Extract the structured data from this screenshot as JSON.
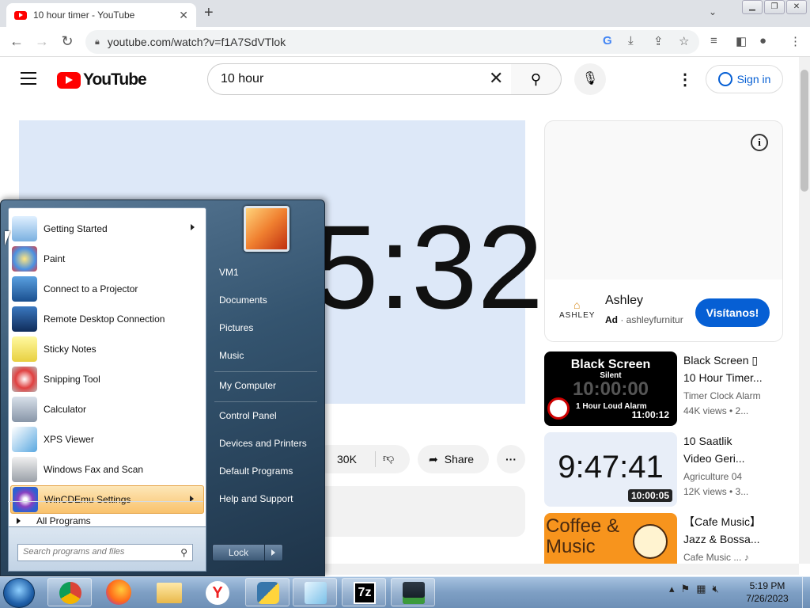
{
  "browser": {
    "tab_title": "10 hour timer - YouTube",
    "url": "youtube.com/watch?v=f1A7SdVTlok",
    "new_tab": "+",
    "close_tab": "✕"
  },
  "youtube": {
    "logo_text": "YouTube",
    "search_value": "10 hour",
    "sign_in": "Sign in",
    "timer_display": "5:32",
    "likes": "30K",
    "share": "Share",
    "more": "···"
  },
  "ad": {
    "brand_logo": "ASHLEY",
    "name": "Ashley",
    "ad_label": "Ad",
    "domain": "· ashleyfurnitur",
    "cta": "Visítanos!"
  },
  "recommended": [
    {
      "title1": "Black Screen ▯",
      "title2": "10 Hour Timer...",
      "channel": "Timer Clock Alarm",
      "stats": "44K views • 2...",
      "duration": "11:00:12",
      "thumb_main": "Black Screen",
      "thumb_sub": "Silent",
      "thumb_ghost": "10:00:00",
      "thumb_caption": "1 Hour Loud Alarm"
    },
    {
      "title1": "10 Saatlik",
      "title2": "Video Geri...",
      "channel": "Agriculture 04",
      "stats": "12K views • 3...",
      "duration": "10:00:05",
      "thumb_main": "9:47:41"
    },
    {
      "title1": "【Cafe Music】",
      "title2": "Jazz & Bossa...",
      "channel": "Cafe Music ... ♪",
      "thumb_main": "Coffee & Music"
    }
  ],
  "start_menu": {
    "programs": [
      {
        "label": "Getting Started",
        "submenu": true
      },
      {
        "label": "Paint"
      },
      {
        "label": "Connect to a Projector"
      },
      {
        "label": "Remote Desktop Connection"
      },
      {
        "label": "Sticky Notes"
      },
      {
        "label": "Snipping Tool"
      },
      {
        "label": "Calculator"
      },
      {
        "label": "XPS Viewer"
      },
      {
        "label": "Windows Fax and Scan"
      },
      {
        "label": "WinCDEmu Settings",
        "submenu": true
      }
    ],
    "all_programs": "All Programs",
    "search_placeholder": "Search programs and files",
    "right_links": [
      "VM1",
      "Documents",
      "Pictures",
      "Music",
      "My Computer",
      "Control Panel",
      "Devices and Printers",
      "Default Programs",
      "Help and Support"
    ],
    "lock_label": "Lock"
  },
  "taskbar": {
    "time": "5:19 PM",
    "date": "7/26/2023",
    "pinned": [
      "Chrome",
      "Firefox",
      "Explorer",
      "Yandex",
      "Python",
      "Notepad",
      "7-Zip",
      "Task Manager"
    ],
    "seven_zip": "7z",
    "yandex": "Y"
  }
}
